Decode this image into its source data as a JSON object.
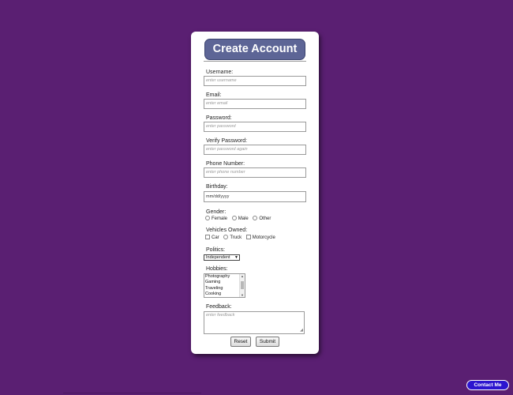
{
  "form": {
    "title": "Create Account",
    "username": {
      "label": "Username:",
      "placeholder": "enter username"
    },
    "email": {
      "label": "Email:",
      "placeholder": "enter email"
    },
    "password": {
      "label": "Password:",
      "placeholder": "enter password"
    },
    "verify_password": {
      "label": "Verify Password:",
      "placeholder": "enter password again"
    },
    "phone": {
      "label": "Phone Number:",
      "placeholder": "enter phone number"
    },
    "birthday": {
      "label": "Birthday:",
      "value": "mm/dd/yyyy"
    },
    "gender": {
      "label": "Gender:",
      "options": [
        "Female",
        "Male",
        "Other"
      ]
    },
    "vehicles": {
      "label": "Vehicles Owned:",
      "options": [
        "Car",
        "Truck",
        "Motorcycle"
      ]
    },
    "politics": {
      "label": "Politics:",
      "selected": "Independent"
    },
    "hobbies": {
      "label": "Hobbies:",
      "options": [
        "Photography",
        "Gaming",
        "Traveling",
        "Cooking"
      ]
    },
    "feedback": {
      "label": "Feedback:",
      "placeholder": "enter feedback"
    },
    "reset_label": "Reset",
    "submit_label": "Submit"
  },
  "contact_label": "Contact Me",
  "colors": {
    "background": "#5a1f72",
    "header": "#5d6596",
    "contact_button": "#2c15cf"
  }
}
